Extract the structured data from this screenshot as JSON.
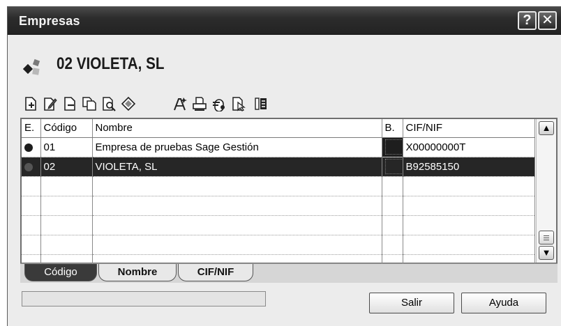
{
  "window": {
    "title": "Empresas"
  },
  "company": {
    "name": "02 VIOLETA, SL"
  },
  "toolbar": {
    "icons": [
      "new-icon",
      "edit-icon",
      "delete-icon",
      "copy-icon",
      "search-icon",
      "options-icon",
      "properties-icon",
      "print-icon",
      "users-icon",
      "cursor-page-icon",
      "columns-icon"
    ]
  },
  "grid": {
    "columns": [
      "E.",
      "Código",
      "Nombre",
      "B.",
      "CIF/NIF"
    ],
    "rows": [
      {
        "codigo": "01",
        "nombre": "Empresa de pruebas Sage Gestión",
        "cif": "X00000000T",
        "selected": false
      },
      {
        "codigo": "02",
        "nombre": "VIOLETA, SL",
        "cif": "B92585150",
        "selected": true
      }
    ]
  },
  "tabs": [
    {
      "label": "Código",
      "active": true
    },
    {
      "label": "Nombre",
      "active": false
    },
    {
      "label": "CIF/NIF",
      "active": false
    }
  ],
  "buttons": {
    "salir": "Salir",
    "ayuda": "Ayuda"
  },
  "colors": {
    "titlebar": "#2c2c2c",
    "selected_row": "#262626"
  }
}
